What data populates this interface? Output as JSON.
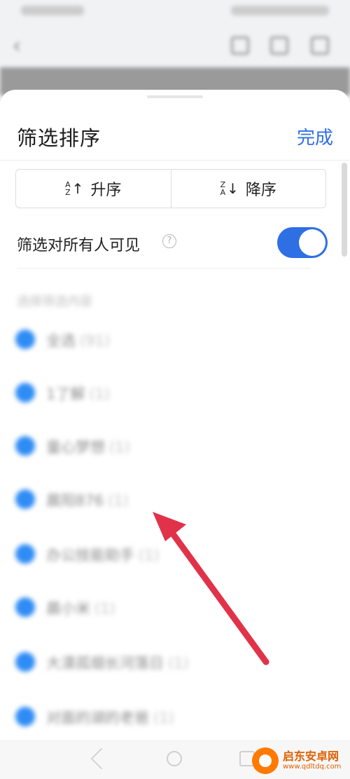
{
  "sheet": {
    "title": "筛选排序",
    "done_label": "完成",
    "sort": {
      "ascending_label": "升序",
      "ascending_icon_top": "A",
      "ascending_icon_bottom": "Z",
      "descending_label": "降序",
      "descending_icon_top": "Z",
      "descending_icon_bottom": "A"
    },
    "visibility": {
      "label": "筛选对所有人可见",
      "help_glyph": "?",
      "toggle_on": true
    },
    "section_hint": "选择筛选内容",
    "items": [
      {
        "label": "全选",
        "count": "(91)"
      },
      {
        "label": "1了解",
        "count": "(1)"
      },
      {
        "label": "童心梦想",
        "count": "(1)"
      },
      {
        "label": "晨阳876",
        "count": "(1)"
      },
      {
        "label": "办公技能助手",
        "count": "(1)"
      },
      {
        "label": "晨小米",
        "count": "(1)"
      },
      {
        "label": "大漠孤烟长河落日",
        "count": "(1)"
      },
      {
        "label": "对面的湖的老爸",
        "count": "(1)"
      }
    ]
  },
  "watermark": {
    "brand": "启东安卓网",
    "url": "www.qdltdq.com"
  },
  "colors": {
    "accent": "#2f6fe4",
    "dot": "#2f8cf5",
    "arrow": "#e0334a"
  }
}
